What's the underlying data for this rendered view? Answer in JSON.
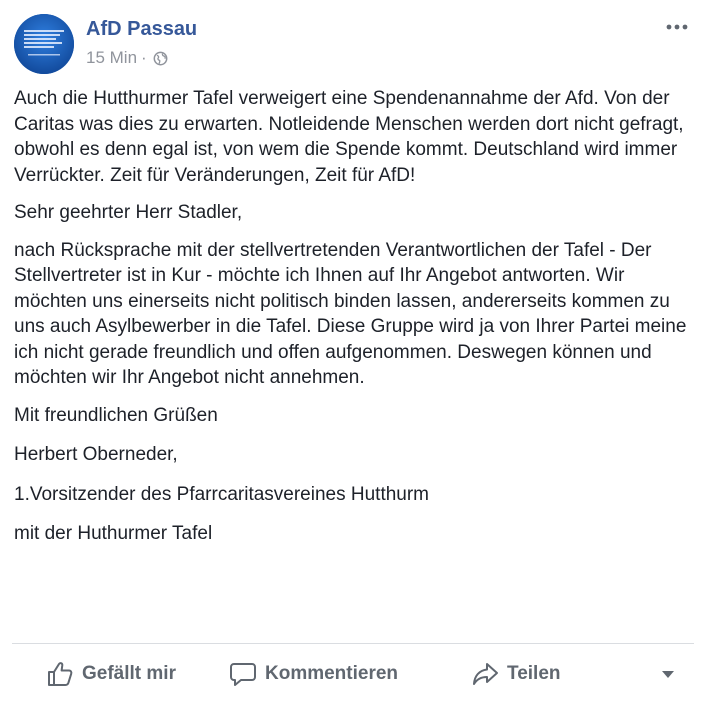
{
  "post": {
    "page_name": "AfD Passau",
    "timestamp": "15 Min",
    "separator": "·",
    "paragraphs": [
      "Auch die Hutthurmer Tafel verweigert eine Spendenannahme der Afd. Von der Caritas was dies zu erwarten. Notleidende Menschen werden dort nicht gefragt, obwohl es denn egal ist, von wem die Spende kommt. Deutschland wird immer Verrückter. Zeit für Veränderungen, Zeit für AfD!",
      "Sehr geehrter Herr Stadler,",
      "nach Rücksprache mit der stellvertretenden Verantwortlichen der Tafel - Der Stellvertreter ist in Kur - möchte ich Ihnen auf Ihr Angebot antworten. Wir möchten uns einerseits nicht politisch binden lassen, andererseits kommen zu uns auch Asylbewerber in die Tafel. Diese Gruppe wird ja von Ihrer Partei meine ich nicht gerade freundlich und offen aufgenommen. Deswegen können und möchten wir Ihr Angebot nicht annehmen.",
      "Mit freundlichen Grüßen",
      "Herbert Oberneder,",
      "1.Vorsitzender des Pfarrcaritasvereines Hutthurm",
      "mit der Huthurmer Tafel"
    ]
  },
  "actions": {
    "like_label": "Gefällt mir",
    "comment_label": "Kommentieren",
    "share_label": "Teilen"
  },
  "icons": {
    "more": "more-horizontal-icon",
    "privacy": "globe-icon",
    "like": "thumbs-up-icon",
    "comment": "speech-bubble-icon",
    "share": "share-arrow-icon",
    "menu": "caret-down-icon"
  },
  "colors": {
    "page_name": "#365899",
    "meta": "#90949c",
    "text": "#1d2129",
    "action": "#606770",
    "divider": "#dadde1",
    "avatar_bg": "#1a5fb4"
  }
}
